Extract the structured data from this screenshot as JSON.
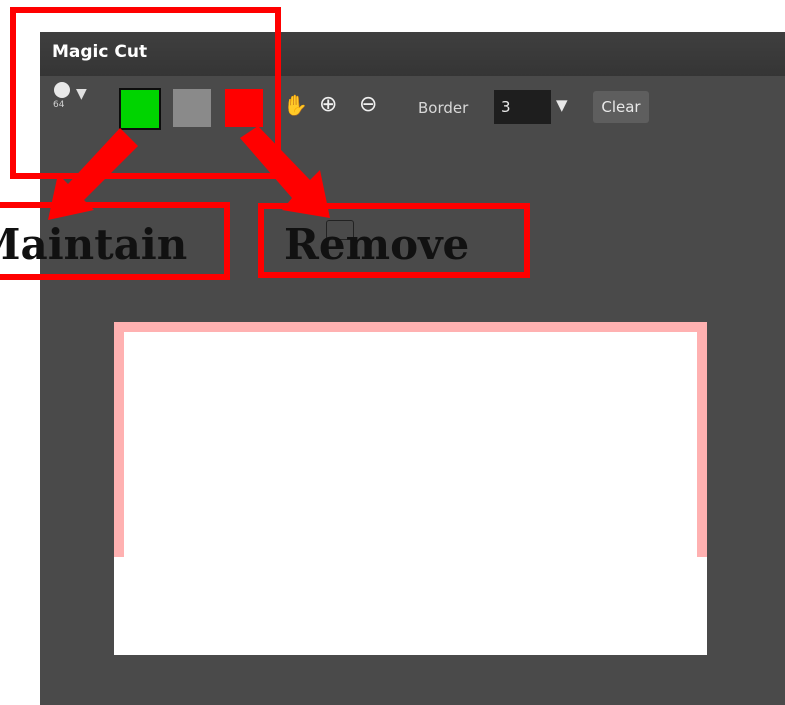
{
  "window": {
    "title": "Magic Cut"
  },
  "toolbar": {
    "brush_size": "64",
    "swatches": [
      {
        "name": "maintain",
        "color": "#00d400"
      },
      {
        "name": "neutral",
        "color": "#8a8a8a"
      },
      {
        "name": "remove",
        "color": "#ff0000"
      }
    ],
    "icons": [
      "brush-icon",
      "hand-icon",
      "zoom-in-icon",
      "zoom-out-icon"
    ],
    "border_label": "Border",
    "border_value": "3",
    "clear_label": "Clear"
  },
  "annotations": {
    "maintain_label": "Maintain",
    "remove_label": "Remove",
    "color": "#ff0000"
  }
}
